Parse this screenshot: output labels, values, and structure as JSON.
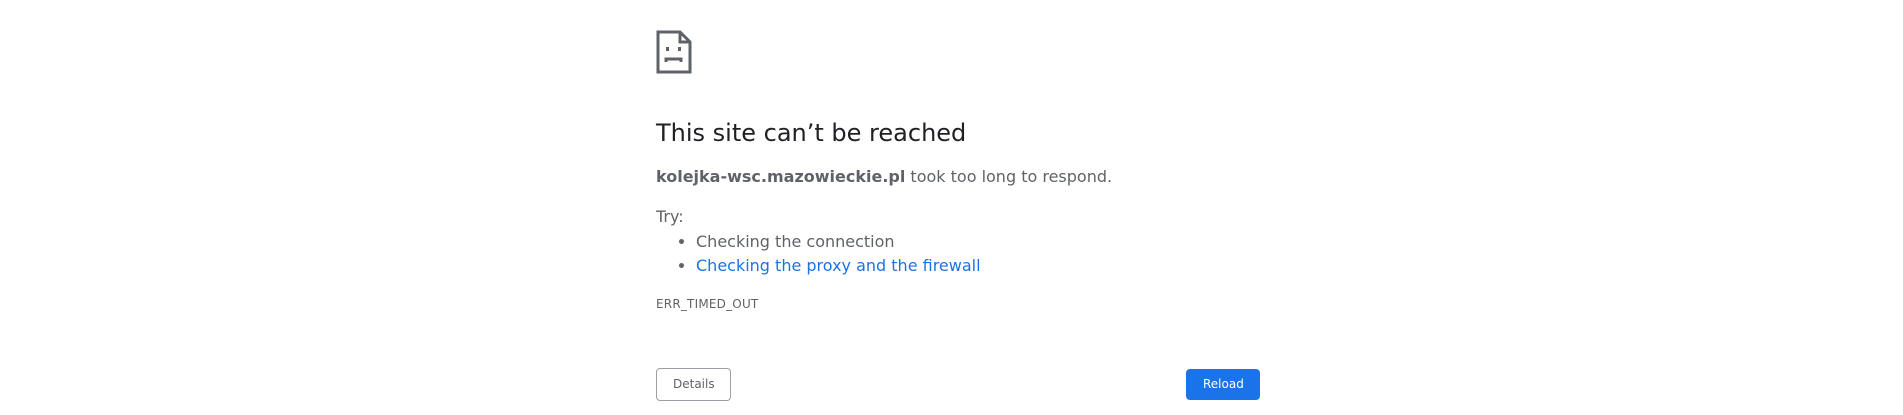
{
  "icon": "sad-page-icon",
  "title": "This site can’t be reached",
  "message": {
    "host": "kolejka-wsc.mazowieckie.pl",
    "text": " took too long to respond."
  },
  "try_label": "Try:",
  "suggestions": [
    {
      "label": "Checking the connection",
      "link": false
    },
    {
      "label": "Checking the proxy and the firewall",
      "link": true
    }
  ],
  "error_code": "ERR_TIMED_OUT",
  "buttons": {
    "details": "Details",
    "reload": "Reload"
  },
  "colors": {
    "title": "#202124",
    "body_text": "#5f6368",
    "link": "#1a73e8",
    "primary_button": "#1a73e8"
  }
}
